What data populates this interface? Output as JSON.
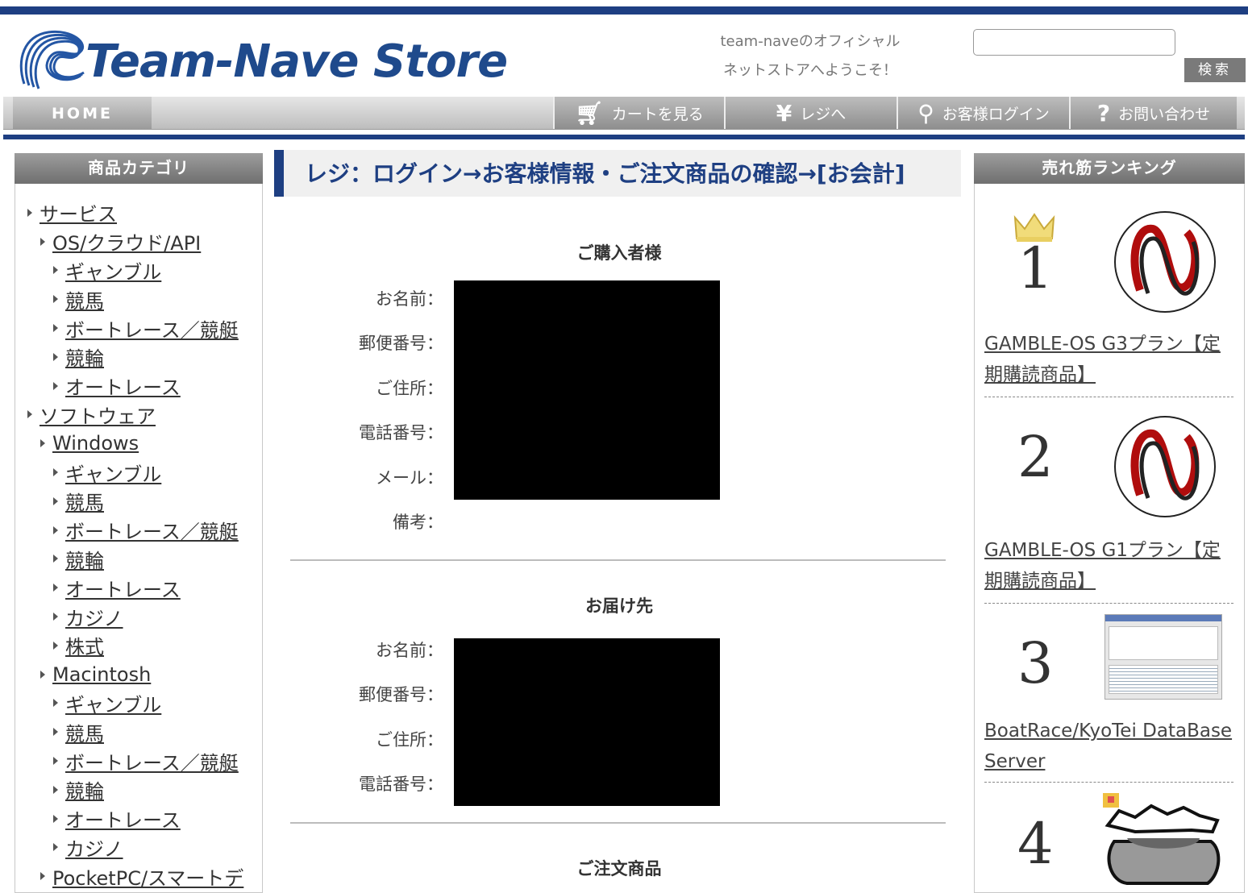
{
  "header": {
    "logo_text": "Team-Nave Store",
    "welcome_line1": "team-naveのオフィシャル",
    "welcome_line2": "ネットストアへようこそ！",
    "search_button": "検索",
    "search_value": ""
  },
  "nav": {
    "home": "HOME",
    "cart": "カートを見る",
    "register": "レジへ",
    "login": "お客様ログイン",
    "contact": "お問い合わせ"
  },
  "left_sidebar": {
    "heading": "商品カテゴリ",
    "items": [
      {
        "label": "サービス",
        "level": 1
      },
      {
        "label": "OS/クラウド/API",
        "level": 2
      },
      {
        "label": "ギャンブル",
        "level": 3
      },
      {
        "label": "競馬",
        "level": 3
      },
      {
        "label": "ボートレース／競艇",
        "level": 3
      },
      {
        "label": "競輪",
        "level": 3
      },
      {
        "label": "オートレース",
        "level": 3
      },
      {
        "label": "ソフトウェア",
        "level": 1
      },
      {
        "label": "Windows",
        "level": 2
      },
      {
        "label": "ギャンブル",
        "level": 3
      },
      {
        "label": "競馬",
        "level": 3
      },
      {
        "label": "ボートレース／競艇",
        "level": 3
      },
      {
        "label": "競輪",
        "level": 3
      },
      {
        "label": "オートレース",
        "level": 3
      },
      {
        "label": "カジノ",
        "level": 3
      },
      {
        "label": "株式",
        "level": 3
      },
      {
        "label": "Macintosh",
        "level": 2
      },
      {
        "label": "ギャンブル",
        "level": 3
      },
      {
        "label": "競馬",
        "level": 3
      },
      {
        "label": "ボートレース／競艇",
        "level": 3
      },
      {
        "label": "競輪",
        "level": 3
      },
      {
        "label": "オートレース",
        "level": 3
      },
      {
        "label": "カジノ",
        "level": 3
      },
      {
        "label": "PocketPC/スマートデ",
        "level": 2
      }
    ]
  },
  "main": {
    "title": "レジ：ログイン→お客様情報・ご注文商品の確認→[お会計]",
    "buyer": {
      "heading": "ご購入者様",
      "labels": [
        "お名前：",
        "郵便番号：",
        "ご住所：",
        "電話番号：",
        "メール：",
        "備考："
      ]
    },
    "delivery": {
      "heading": "お届け先",
      "labels": [
        "お名前：",
        "郵便番号：",
        "ご住所：",
        "電話番号："
      ]
    },
    "order": {
      "heading": "ご注文商品"
    }
  },
  "right_sidebar": {
    "heading": "売れ筋ランキング",
    "ranking": [
      {
        "rank": "1",
        "name": "GAMBLE-OS G3プラン【定期購読商品】",
        "icon": "nave-logo-icon"
      },
      {
        "rank": "2",
        "name": "GAMBLE-OS G1プラン【定期購読商品】",
        "icon": "nave-logo-icon"
      },
      {
        "rank": "3",
        "name": "BoatRace/KyoTei DataBase Server",
        "icon": "software-screenshot-icon"
      },
      {
        "rank": "4",
        "name": "",
        "icon": "dog-illustration-icon"
      }
    ]
  },
  "colors": {
    "brand": "#1e3f82",
    "nav_gray": "#8e8e8e",
    "sidebar_head": "#6f6f6f",
    "logo_red": "#b00d0d"
  }
}
